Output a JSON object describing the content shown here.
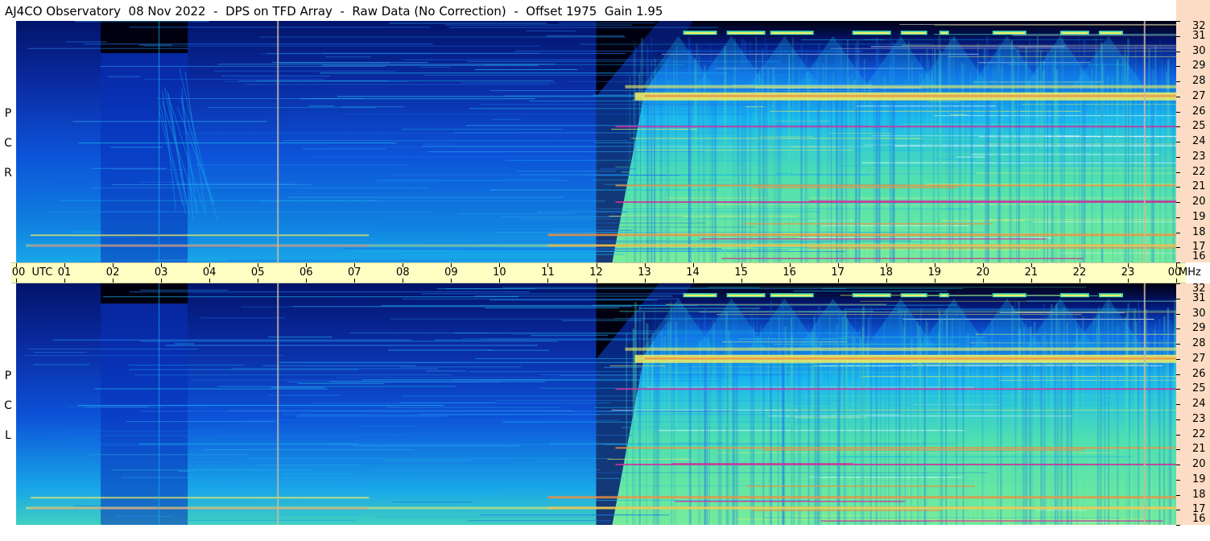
{
  "title": "AJ4CO Observatory  08 Nov 2022  -  DPS on TFD Array  -  Raw Data (No Correction)  -  Offset 1975  Gain 1.95",
  "colors": {
    "background_blue": "#0a3fd8",
    "deep_blue": "#02146a",
    "black": "#000010",
    "cyan": "#19b8f0",
    "green_cyan": "#4fe0b0",
    "yellow": "#f4f060",
    "orange": "#f09040",
    "magenta": "#d0309a",
    "axis_band": "#ffffc4",
    "freq_band": "#fcdcc4",
    "marker_line": "#c8b8a0"
  },
  "chart_data": {
    "type": "heatmap",
    "description_units": "time (UTC hours) vs frequency (MHz)",
    "x": {
      "unit": "UTC",
      "tick_labels": [
        "00",
        "01",
        "02",
        "03",
        "04",
        "05",
        "06",
        "07",
        "08",
        "09",
        "10",
        "11",
        "12",
        "13",
        "14",
        "15",
        "16",
        "17",
        "18",
        "19",
        "20",
        "21",
        "22",
        "23",
        "00"
      ],
      "range": [
        0,
        24
      ]
    },
    "y": {
      "unit": "MHz",
      "tick_labels": [
        "16",
        "17",
        "18",
        "19",
        "20",
        "21",
        "22",
        "23",
        "24",
        "25",
        "26",
        "27",
        "28",
        "29",
        "30",
        "31",
        "32"
      ],
      "range": [
        16,
        32
      ]
    },
    "panels": [
      {
        "name": "RCP",
        "letters": [
          "P",
          "C",
          "R"
        ]
      },
      {
        "name": "LCP",
        "letters": [
          "P",
          "C",
          "L"
        ]
      }
    ],
    "marker_times_utc": [
      5.4,
      23.33
    ],
    "features": {
      "night_dark_block_utc": [
        1.75,
        3.55
      ],
      "dayside_onset_utc": 12.0,
      "ripple_columns_utc": [
        [
          13.5,
          22.9
        ]
      ],
      "strong_bands_mhz": [
        27.0,
        25.0,
        21.1,
        20.0,
        17.8,
        17.1
      ]
    }
  },
  "labels": {
    "utc": "UTC",
    "mhz": "MHz"
  }
}
